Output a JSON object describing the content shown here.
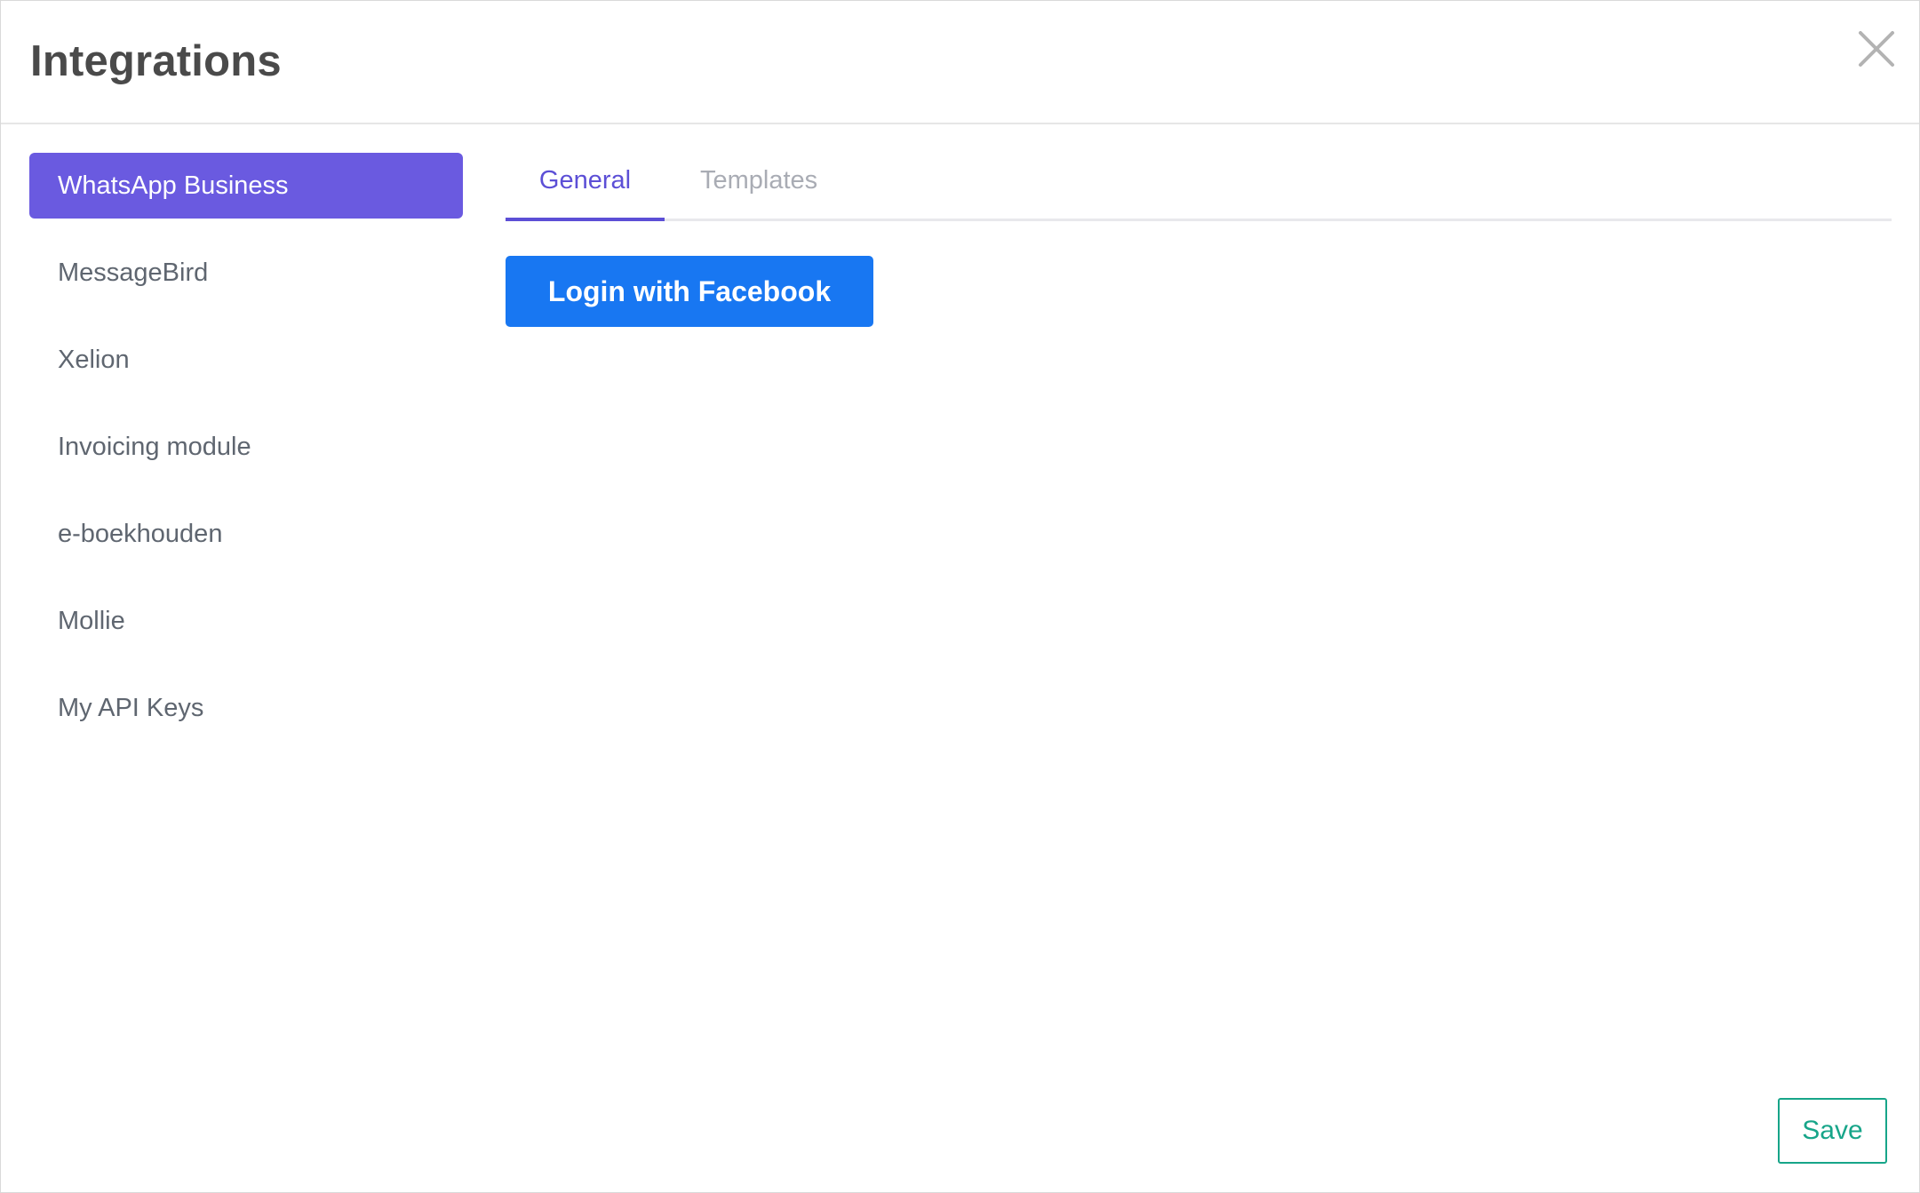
{
  "modal": {
    "title": "Integrations",
    "close_icon": "close-icon"
  },
  "sidebar": {
    "items": [
      {
        "label": "WhatsApp Business",
        "active": true
      },
      {
        "label": "MessageBird",
        "active": false
      },
      {
        "label": "Xelion",
        "active": false
      },
      {
        "label": "Invoicing module",
        "active": false
      },
      {
        "label": "e-boekhouden",
        "active": false
      },
      {
        "label": "Mollie",
        "active": false
      },
      {
        "label": "My API Keys",
        "active": false
      }
    ]
  },
  "tabs": [
    {
      "label": "General",
      "active": true
    },
    {
      "label": "Templates",
      "active": false
    }
  ],
  "main": {
    "login_button_label": "Login with Facebook"
  },
  "footer": {
    "save_label": "Save"
  },
  "colors": {
    "accent": "#6a5ae0",
    "facebook": "#1877f2",
    "save": "#17a589"
  }
}
